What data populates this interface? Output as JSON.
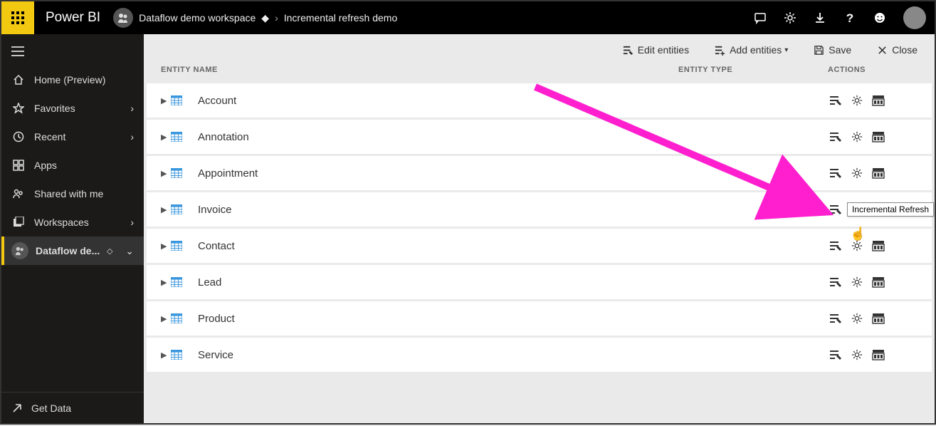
{
  "app": {
    "brand": "Power BI"
  },
  "breadcrumb": {
    "workspace": "Dataflow demo workspace",
    "item": "Incremental refresh demo"
  },
  "nav": {
    "home": "Home (Preview)",
    "favorites": "Favorites",
    "recent": "Recent",
    "apps": "Apps",
    "shared": "Shared with me",
    "workspaces": "Workspaces",
    "current_ws": "Dataflow de...",
    "get_data": "Get Data"
  },
  "toolbar": {
    "edit": "Edit entities",
    "add": "Add entities",
    "save": "Save",
    "close": "Close"
  },
  "columns": {
    "name": "ENTITY NAME",
    "type": "ENTITY TYPE",
    "actions": "ACTIONS"
  },
  "entities": [
    {
      "name": "Account"
    },
    {
      "name": "Annotation"
    },
    {
      "name": "Appointment"
    },
    {
      "name": "Invoice"
    },
    {
      "name": "Contact"
    },
    {
      "name": "Lead"
    },
    {
      "name": "Product"
    },
    {
      "name": "Service"
    }
  ],
  "tooltip": "Incremental Refresh",
  "colors": {
    "accent": "#f2c811",
    "annotation": "#ff1fce"
  }
}
